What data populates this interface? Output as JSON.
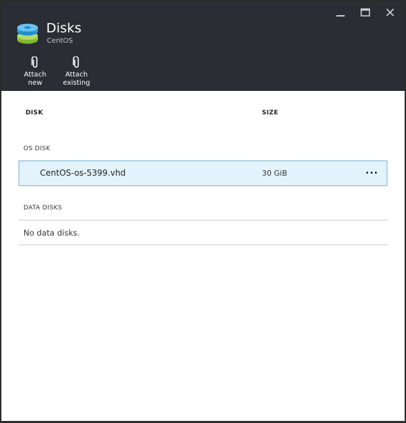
{
  "header": {
    "title": "Disks",
    "subtitle": "CentOS",
    "icon": "disks-icon",
    "window_controls": [
      "minimize-icon",
      "maximize-icon",
      "close-icon"
    ]
  },
  "commands": {
    "attach_new": {
      "line1": "Attach new",
      "icon": "paperclip-icon"
    },
    "attach_existing": {
      "line1": "Attach",
      "line2": "existing",
      "icon": "paperclip-icon"
    }
  },
  "table": {
    "columns": {
      "disk": "DISK",
      "size": "SIZE"
    },
    "os_disk": {
      "section_label": "OS DISK",
      "name": "CentOS-os-5399.vhd",
      "size": "30 GiB",
      "more": "..."
    },
    "data_disks": {
      "section_label": "DATA DISKS",
      "empty_message": "No data disks."
    }
  },
  "colors": {
    "header_bg": "#2a2d33",
    "selected_row_bg": "#e3f3fb",
    "selected_row_border": "#74b1d8"
  }
}
